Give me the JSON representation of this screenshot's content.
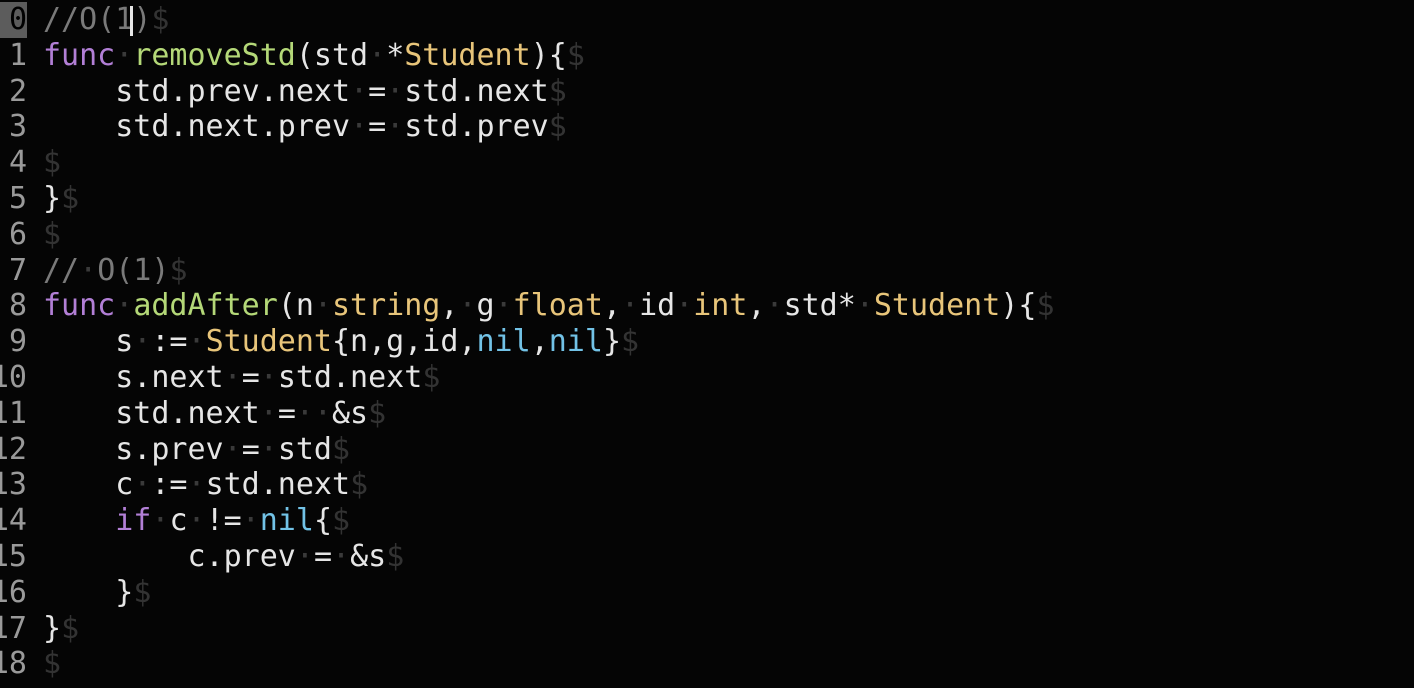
{
  "editor": {
    "eol_marker": "$",
    "cursor_line": 0,
    "lines": [
      {
        "number": "0",
        "tokens": [
          {
            "t": "comment",
            "v": "//O(1"
          },
          {
            "t": "cursor",
            "v": ""
          },
          {
            "t": "comment",
            "v": ")"
          }
        ]
      },
      {
        "number": "1",
        "tokens": [
          {
            "t": "keyword",
            "v": "func"
          },
          {
            "t": "space",
            "v": "·"
          },
          {
            "t": "func",
            "v": "removeStd"
          },
          {
            "t": "text",
            "v": "(std"
          },
          {
            "t": "space",
            "v": "·"
          },
          {
            "t": "text",
            "v": "*"
          },
          {
            "t": "type",
            "v": "Student"
          },
          {
            "t": "text",
            "v": "){"
          }
        ]
      },
      {
        "number": "2",
        "tokens": [
          {
            "t": "text",
            "v": "    std.prev.next"
          },
          {
            "t": "space",
            "v": "·"
          },
          {
            "t": "text",
            "v": "="
          },
          {
            "t": "space",
            "v": "·"
          },
          {
            "t": "text",
            "v": "std.next"
          }
        ]
      },
      {
        "number": "3",
        "tokens": [
          {
            "t": "text",
            "v": "    std.next.prev"
          },
          {
            "t": "space",
            "v": "·"
          },
          {
            "t": "text",
            "v": "="
          },
          {
            "t": "space",
            "v": "·"
          },
          {
            "t": "text",
            "v": "std.prev"
          }
        ]
      },
      {
        "number": "4",
        "tokens": []
      },
      {
        "number": "5",
        "tokens": [
          {
            "t": "text",
            "v": "}"
          }
        ]
      },
      {
        "number": "6",
        "tokens": []
      },
      {
        "number": "7",
        "tokens": [
          {
            "t": "comment",
            "v": "//"
          },
          {
            "t": "space",
            "v": "·"
          },
          {
            "t": "comment",
            "v": "O(1)"
          }
        ]
      },
      {
        "number": "8",
        "tokens": [
          {
            "t": "keyword",
            "v": "func"
          },
          {
            "t": "space",
            "v": "·"
          },
          {
            "t": "func",
            "v": "addAfter"
          },
          {
            "t": "text",
            "v": "(n"
          },
          {
            "t": "space",
            "v": "·"
          },
          {
            "t": "type",
            "v": "string"
          },
          {
            "t": "text",
            "v": ","
          },
          {
            "t": "space",
            "v": "·"
          },
          {
            "t": "text",
            "v": "g"
          },
          {
            "t": "space",
            "v": "·"
          },
          {
            "t": "type",
            "v": "float"
          },
          {
            "t": "text",
            "v": ","
          },
          {
            "t": "space",
            "v": "·"
          },
          {
            "t": "text",
            "v": "id"
          },
          {
            "t": "space",
            "v": "·"
          },
          {
            "t": "type",
            "v": "int"
          },
          {
            "t": "text",
            "v": ","
          },
          {
            "t": "space",
            "v": "·"
          },
          {
            "t": "text",
            "v": "std*"
          },
          {
            "t": "space",
            "v": "·"
          },
          {
            "t": "type",
            "v": "Student"
          },
          {
            "t": "text",
            "v": "){"
          }
        ]
      },
      {
        "number": "9",
        "tokens": [
          {
            "t": "text",
            "v": "    s"
          },
          {
            "t": "space",
            "v": "·"
          },
          {
            "t": "text",
            "v": ":="
          },
          {
            "t": "space",
            "v": "·"
          },
          {
            "t": "type",
            "v": "Student"
          },
          {
            "t": "text",
            "v": "{n,g,id,"
          },
          {
            "t": "nil",
            "v": "nil"
          },
          {
            "t": "text",
            "v": ","
          },
          {
            "t": "nil",
            "v": "nil"
          },
          {
            "t": "text",
            "v": "}"
          }
        ]
      },
      {
        "number": "10",
        "tokens": [
          {
            "t": "text",
            "v": "    s.next"
          },
          {
            "t": "space",
            "v": "·"
          },
          {
            "t": "text",
            "v": "="
          },
          {
            "t": "space",
            "v": "·"
          },
          {
            "t": "text",
            "v": "std.next"
          }
        ]
      },
      {
        "number": "11",
        "tokens": [
          {
            "t": "text",
            "v": "    std.next"
          },
          {
            "t": "space",
            "v": "·"
          },
          {
            "t": "text",
            "v": "="
          },
          {
            "t": "space",
            "v": "··"
          },
          {
            "t": "text",
            "v": "&s"
          }
        ]
      },
      {
        "number": "12",
        "tokens": [
          {
            "t": "text",
            "v": "    s.prev"
          },
          {
            "t": "space",
            "v": "·"
          },
          {
            "t": "text",
            "v": "="
          },
          {
            "t": "space",
            "v": "·"
          },
          {
            "t": "text",
            "v": "std"
          }
        ]
      },
      {
        "number": "13",
        "tokens": [
          {
            "t": "text",
            "v": "    c"
          },
          {
            "t": "space",
            "v": "·"
          },
          {
            "t": "text",
            "v": ":="
          },
          {
            "t": "space",
            "v": "·"
          },
          {
            "t": "text",
            "v": "std.next"
          }
        ]
      },
      {
        "number": "14",
        "tokens": [
          {
            "t": "keyword",
            "v": "    if"
          },
          {
            "t": "space",
            "v": "·"
          },
          {
            "t": "text",
            "v": "c"
          },
          {
            "t": "space",
            "v": "·"
          },
          {
            "t": "text",
            "v": "!="
          },
          {
            "t": "space",
            "v": "·"
          },
          {
            "t": "nil",
            "v": "nil"
          },
          {
            "t": "text",
            "v": "{"
          }
        ]
      },
      {
        "number": "15",
        "tokens": [
          {
            "t": "text",
            "v": "        c.prev"
          },
          {
            "t": "space",
            "v": "·"
          },
          {
            "t": "text",
            "v": "="
          },
          {
            "t": "space",
            "v": "·"
          },
          {
            "t": "text",
            "v": "&s"
          }
        ]
      },
      {
        "number": "16",
        "tokens": [
          {
            "t": "text",
            "v": "    }"
          }
        ]
      },
      {
        "number": "17",
        "tokens": [
          {
            "t": "text",
            "v": "}"
          }
        ]
      },
      {
        "number": "18",
        "tokens": []
      }
    ]
  }
}
